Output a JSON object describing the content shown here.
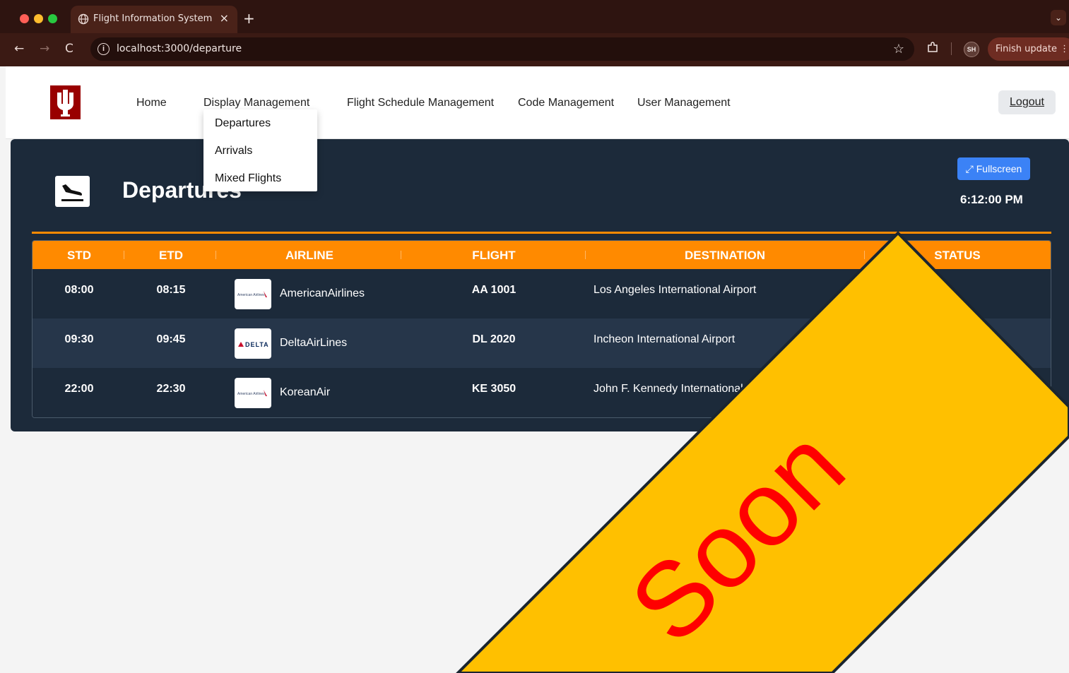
{
  "browser": {
    "tab_title": "Flight Information System",
    "tab_close": "×",
    "new_tab": "+",
    "url": "localhost:3000/departure",
    "avatar_initials": "SH",
    "finish_update": "Finish update ⋮",
    "nav_back": "←",
    "nav_forward": "→",
    "nav_reload": "C",
    "star": "☆"
  },
  "header": {
    "menu": {
      "home": "Home",
      "display": "Display Management",
      "schedule": "Flight Schedule Management",
      "code": "Code Management",
      "user": "User Management"
    },
    "logout": "Logout",
    "brand_color": "#990000"
  },
  "dropdown": {
    "items": [
      "Departures",
      "Arrivals",
      "Mixed Flights"
    ]
  },
  "board": {
    "title": "Departures",
    "fullscreen_label": "⤢ Fullscreen",
    "clock": "6:12:00 PM",
    "accent_color": "#ff8a00",
    "columns": [
      "STD",
      "ETD",
      "AIRLINE",
      "FLIGHT",
      "DESTINATION",
      "STATUS"
    ],
    "rows": [
      {
        "std": "08:00",
        "etd": "08:15",
        "airline": "AmericanAirlines",
        "logo_text": "American Airlines",
        "flight": "AA 1001",
        "destination": "Los Angeles International Airport"
      },
      {
        "std": "09:30",
        "etd": "09:45",
        "airline": "DeltaAirLines",
        "logo_text": "DELTA",
        "flight": "DL 2020",
        "destination": "Incheon International Airport"
      },
      {
        "std": "22:00",
        "etd": "22:30",
        "airline": "KoreanAir",
        "logo_text": "American Airlines",
        "flight": "KE 3050",
        "destination": "John F. Kennedy International"
      }
    ]
  },
  "banner": {
    "text": "Soon",
    "fill_color": "#ffc000",
    "text_color": "#ff0000"
  }
}
